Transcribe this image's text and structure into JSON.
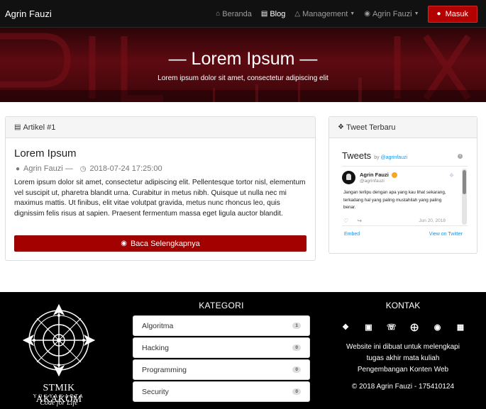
{
  "navbar": {
    "brand": "Agrin Fauzi",
    "items": [
      {
        "label": "Beranda",
        "icon": "home-icon",
        "active": false
      },
      {
        "label": "Blog",
        "icon": "newspaper-icon",
        "active": true
      },
      {
        "label": "Management",
        "icon": "sitemap-icon",
        "active": false,
        "dropdown": true
      },
      {
        "label": "Agrin Fauzi",
        "icon": "user-circle-icon",
        "active": false,
        "dropdown": true
      }
    ],
    "login_label": "Masuk"
  },
  "hero": {
    "title": "— Lorem Ipsum —",
    "subtitle": "Lorem ipsum dolor sit amet, consectetur adipiscing elit"
  },
  "article": {
    "heading": "Artikel #1",
    "title": "Lorem Ipsum",
    "author": "Agrin Fauzi —",
    "date": "2018-07-24 17:25:00",
    "body": "Lorem ipsum dolor sit amet, consectetur adipiscing elit. Pellentesque tortor nisl, elementum vel suscipit ut, pharetra blandit urna. Curabitur in metus nibh. Quisque ut nulla nec mi maximus mattis. Ut finibus, elit vitae volutpat gravida, metus nunc rhoncus leo, quis dignissim felis risus at sapien. Praesent fermentum massa eget ligula auctor blandit.",
    "read_more": "Baca Selengkapnya"
  },
  "tweets": {
    "heading": "Tweet Terbaru",
    "title": "Tweets",
    "by": "by",
    "handle": "@agrinfauzi",
    "info": "i",
    "tweet": {
      "name": "Agrin Fauzi",
      "user": "@agrinfauzi",
      "text": "Jangan terlipu dengan apa yang kau lihat sekarang, terkadang hal yang paling mustahilah yang paling benar.",
      "date": "Jun 20, 2018"
    },
    "embed": "Embed",
    "view": "View on Twitter"
  },
  "footer": {
    "logo": {
      "name": "STMIK AKAKOM",
      "city": "YOGYAKARTA",
      "tagline": "Code for Life"
    },
    "kategori": {
      "title": "KATEGORI",
      "items": [
        {
          "label": "Algoritma",
          "count": "1"
        },
        {
          "label": "Hacking",
          "count": "0"
        },
        {
          "label": "Programming",
          "count": "0"
        },
        {
          "label": "Security",
          "count": "0"
        }
      ]
    },
    "kontak": {
      "title": "KONTAK",
      "icons": [
        "twitter-icon",
        "instagram-icon",
        "whatsapp-icon",
        "google-plus-icon",
        "github-icon",
        "steam-icon"
      ],
      "text_lines": [
        "Website ini dibuat untuk melengkapi",
        "tugas akhir mata kuliah",
        "Pengembangan Konten Web"
      ],
      "copyright": "© 2018 Agrin Fauzi - 175410124"
    }
  },
  "colors": {
    "accent_red": "#b30000",
    "navbar_bg": "#111111",
    "footer_bg": "#000000",
    "twitter_blue": "#1b95e0"
  }
}
